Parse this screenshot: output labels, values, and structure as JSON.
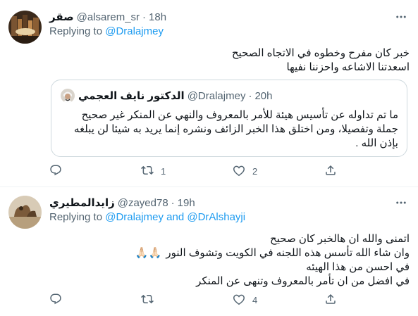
{
  "tweet1": {
    "name": "صقر",
    "handle": "@alsarem_sr",
    "time": "18h",
    "replying_prefix": "Replying to",
    "replying_to": "@Dralajmey",
    "text_lines": [
      "خبر كان مفرح وخطوه في الاتجاه الصحيح",
      "اسعدتنا الاشاعه واحزننا نفيها"
    ],
    "quote": {
      "name": "الدكتور نايف العجمي",
      "handle": "@Dralajmey",
      "time": "20h",
      "text_lines": [
        "ما تم تداوله عن تأسيس هيئة للأمر بالمعروف والنهي عن المنكر غير صحيح",
        "جملة وتفصيلا، ومن اختلق هذا الخبر الزائف ونشره إنما يريد به شيئا لن يبلغه",
        "بإذن الله ."
      ]
    },
    "counts": {
      "reply": "",
      "retweet": "1",
      "like": "2"
    }
  },
  "tweet2": {
    "name": "زايدالمطيري",
    "handle": "@zayed78",
    "time": "19h",
    "replying_prefix": "Replying to",
    "replying_to_1": "@Dralajmey",
    "replying_and": "and",
    "replying_to_2": "@DrAlshayji",
    "text_lines": [
      "اتمنى والله ان هالخبر كان صحيح",
      "وان شاء الله تأسس هذه اللجنه في الكويت وتشوف النور",
      "في احسن من هذا الهيئه",
      "في افضل من ان تأمر بالمعروف وتنهى عن المنكر"
    ],
    "emoji": "🙏🏻🙏🏻",
    "counts": {
      "reply": "",
      "retweet": "",
      "like": "4"
    }
  },
  "dot": "·",
  "colors": {
    "accent": "#1d9bf0",
    "secondary": "#536471",
    "border": "#cfd9de"
  }
}
